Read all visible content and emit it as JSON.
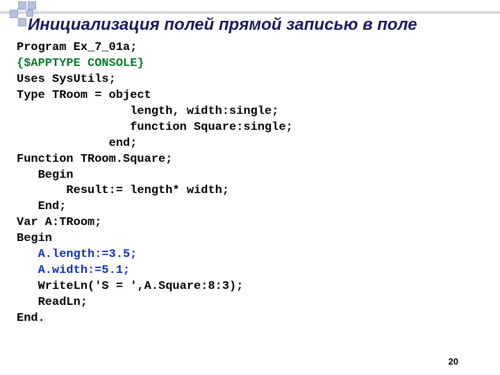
{
  "title": "Инициализация полей прямой записью в поле",
  "page_number": "20",
  "code": {
    "l01": "Program Ex_7_01a;",
    "l02": "{$APPTYPE CONSOLE}",
    "l03": "Uses SysUtils;",
    "l04": "Type TRoom = object",
    "l05": "                length, width:single;",
    "l06": "                function Square:single;",
    "l07": "             end;",
    "l08": "Function TRoom.Square;",
    "l09": "   Begin",
    "l10": "       Result:= length* width;",
    "l11": "   End;",
    "l12": "Var A:TRoom;",
    "l13": "Begin",
    "l14": "   A.length:=3.5;",
    "l15": "   A.width:=5.1;",
    "l16": "   WriteLn('S = ',A.Square:8:3);",
    "l17": "   ReadLn;",
    "l18": "End."
  }
}
